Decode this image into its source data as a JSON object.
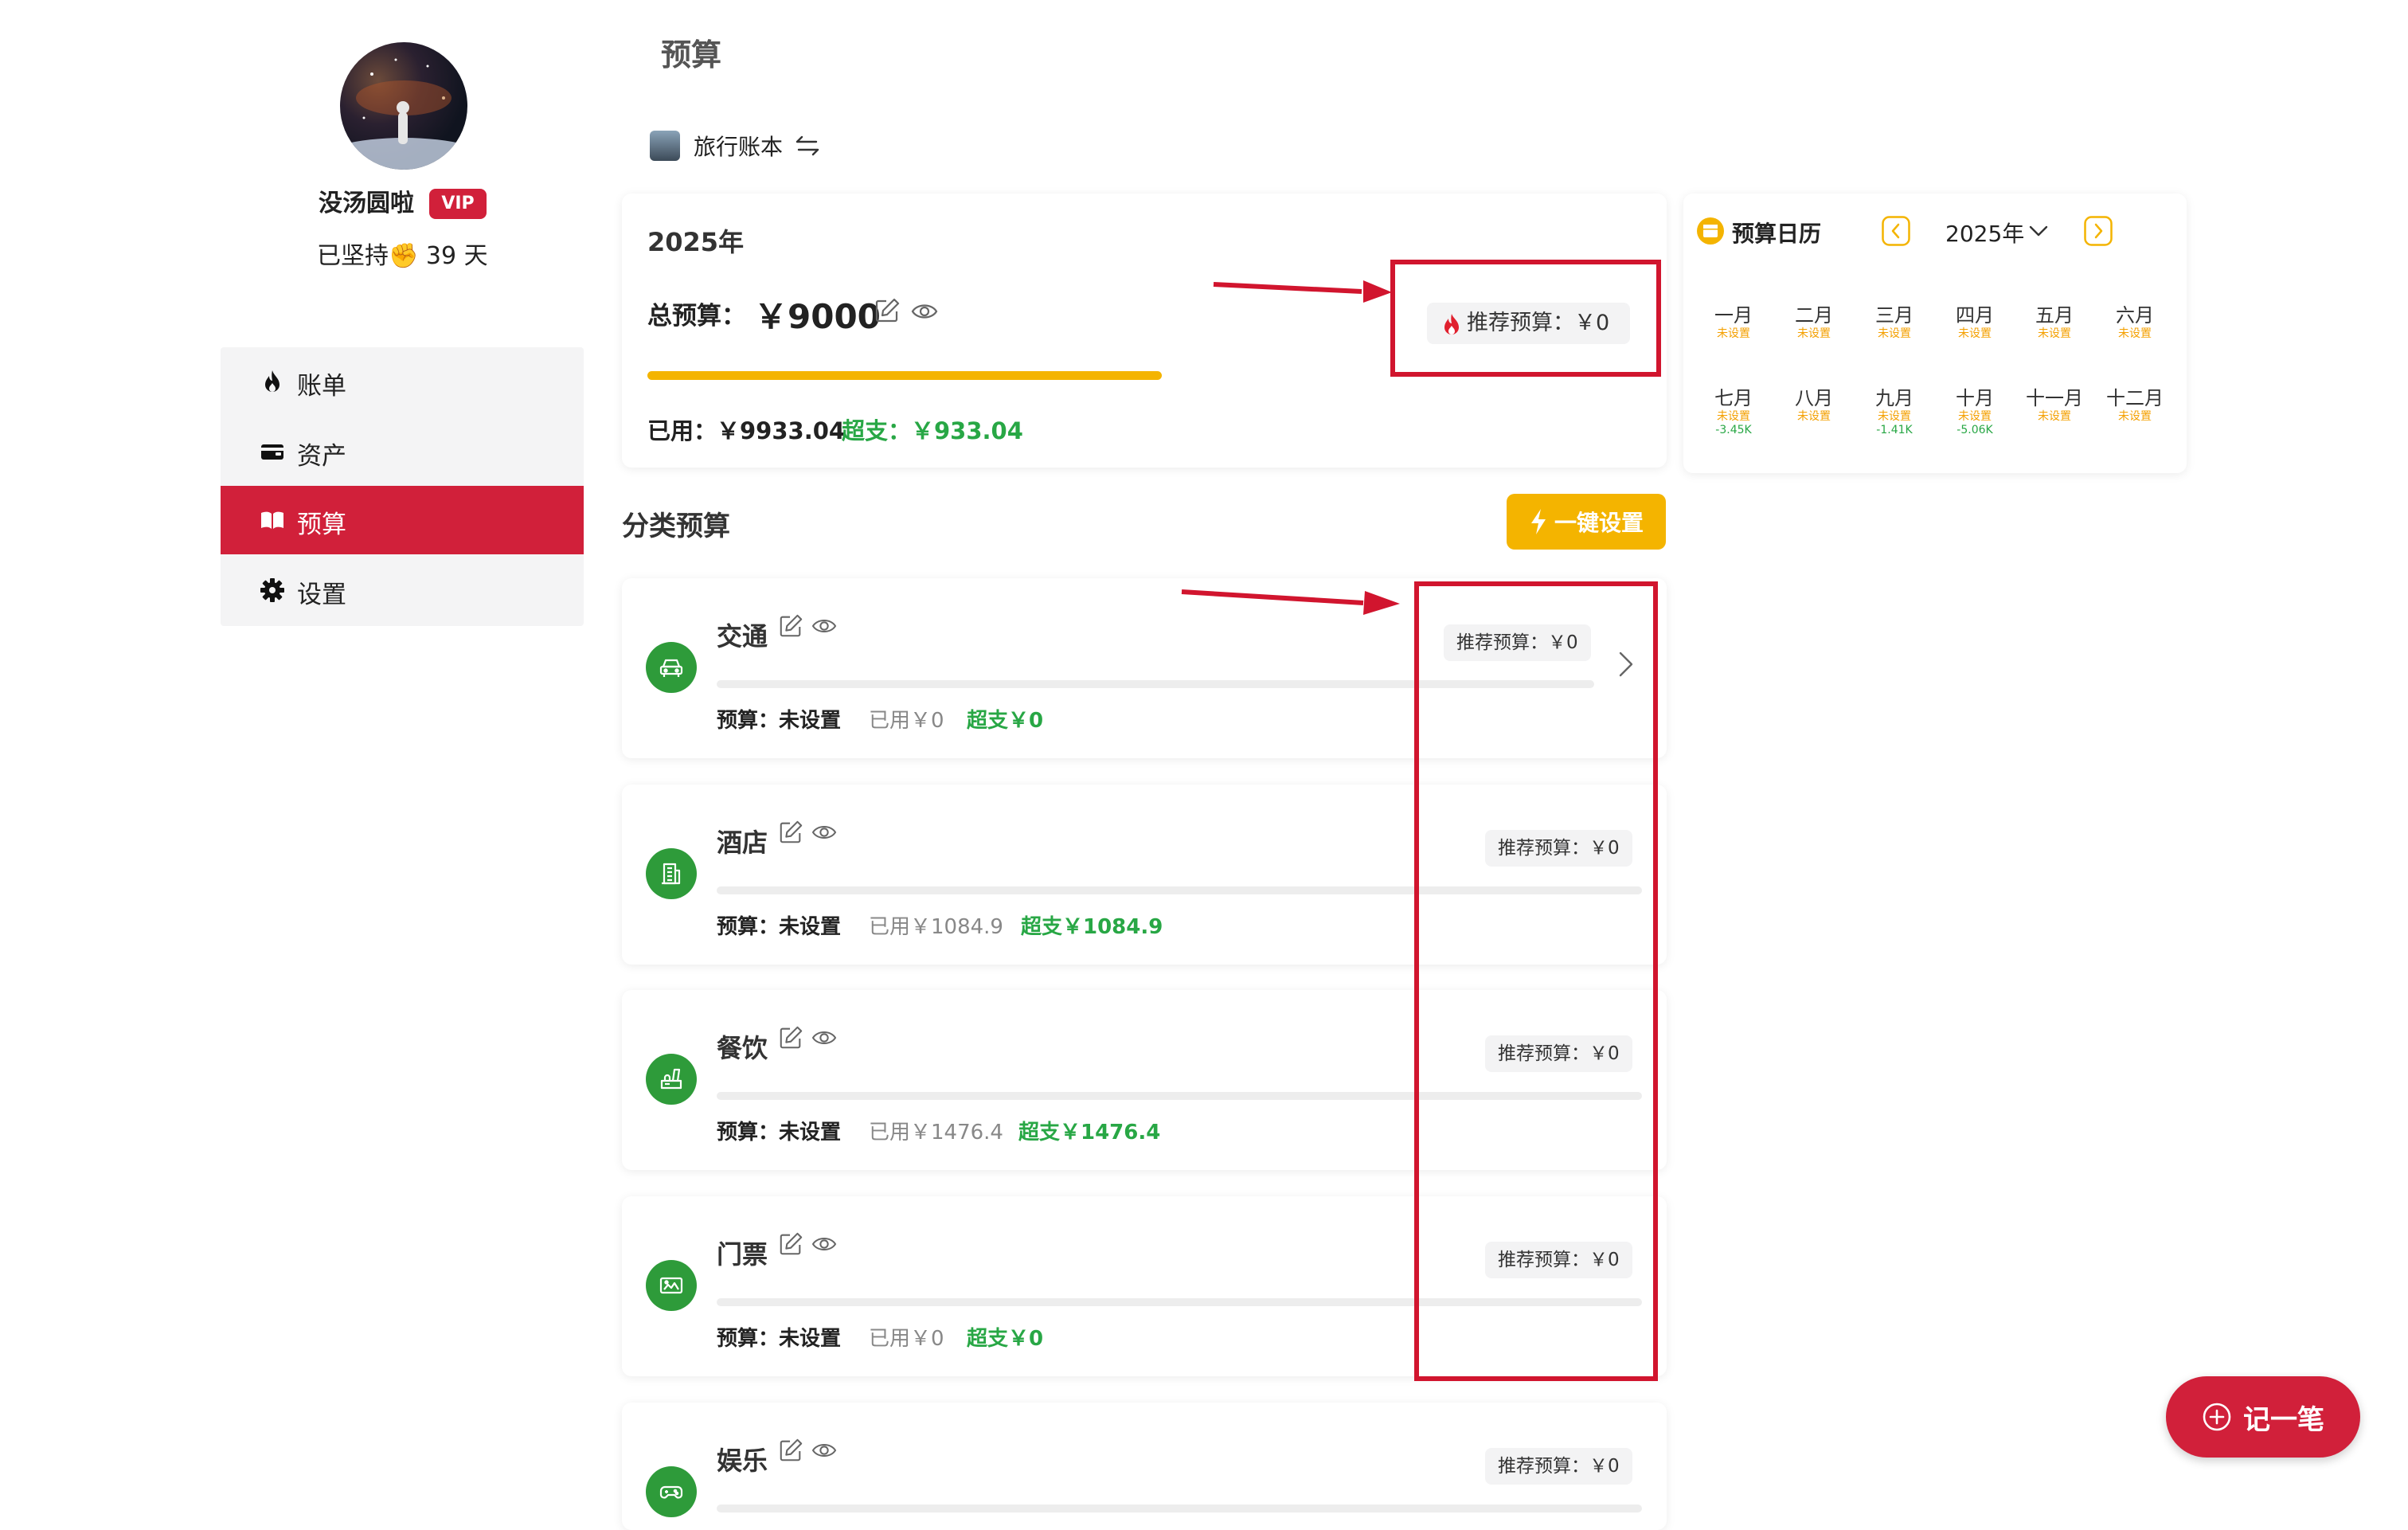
{
  "profile": {
    "username": "没汤圆啦",
    "vip": "VIP",
    "streak": "已坚持✊ 39 天"
  },
  "nav": [
    {
      "label": "账单",
      "icon": "fire-icon"
    },
    {
      "label": "资产",
      "icon": "wallet-icon"
    },
    {
      "label": "预算",
      "icon": "book-icon",
      "active": true
    },
    {
      "label": "设置",
      "icon": "gear-icon"
    }
  ],
  "page": {
    "title": "预算",
    "book": "旅行账本"
  },
  "total": {
    "year": "2025年",
    "label": "总预算：",
    "value": "￥9000",
    "used": "已用：￥9933.04",
    "over": "超支：￥933.04",
    "recommend": "推荐预算：￥0",
    "progress": 1.0
  },
  "calendar": {
    "title": "预算日历",
    "year": "2025年",
    "months": [
      {
        "name": "一月",
        "status": "未设置",
        "value": ""
      },
      {
        "name": "二月",
        "status": "未设置",
        "value": ""
      },
      {
        "name": "三月",
        "status": "未设置",
        "value": ""
      },
      {
        "name": "四月",
        "status": "未设置",
        "value": ""
      },
      {
        "name": "五月",
        "status": "未设置",
        "value": ""
      },
      {
        "name": "六月",
        "status": "未设置",
        "value": ""
      },
      {
        "name": "七月",
        "status": "未设置",
        "value": "-3.45K"
      },
      {
        "name": "八月",
        "status": "未设置",
        "value": ""
      },
      {
        "name": "九月",
        "status": "未设置",
        "value": "-1.41K"
      },
      {
        "name": "十月",
        "status": "未设置",
        "value": "-5.06K"
      },
      {
        "name": "十一月",
        "status": "未设置",
        "value": ""
      },
      {
        "name": "十二月",
        "status": "未设置",
        "value": ""
      }
    ]
  },
  "categories_section": {
    "title": "分类预算",
    "quick_set": "一键设置"
  },
  "categories": [
    {
      "name": "交通",
      "budget": "预算：未设置",
      "used": "已用￥0",
      "over": "超支￥0",
      "recommend": "推荐预算：￥0"
    },
    {
      "name": "酒店",
      "budget": "预算：未设置",
      "used": "已用￥1084.9",
      "over": "超支￥1084.9",
      "recommend": "推荐预算：￥0"
    },
    {
      "name": "餐饮",
      "budget": "预算：未设置",
      "used": "已用￥1476.4",
      "over": "超支￥1476.4",
      "recommend": "推荐预算：￥0"
    },
    {
      "name": "门票",
      "budget": "预算：未设置",
      "used": "已用￥0",
      "over": "超支￥0",
      "recommend": "推荐预算：￥0"
    },
    {
      "name": "娱乐",
      "recommend": "推荐预算：￥0"
    }
  ],
  "fab": {
    "label": "记一笔"
  },
  "colors": {
    "accent": "#d1203a",
    "budget_bar": "#f4b400",
    "success": "#28a745",
    "annotation": "#d1152e"
  }
}
